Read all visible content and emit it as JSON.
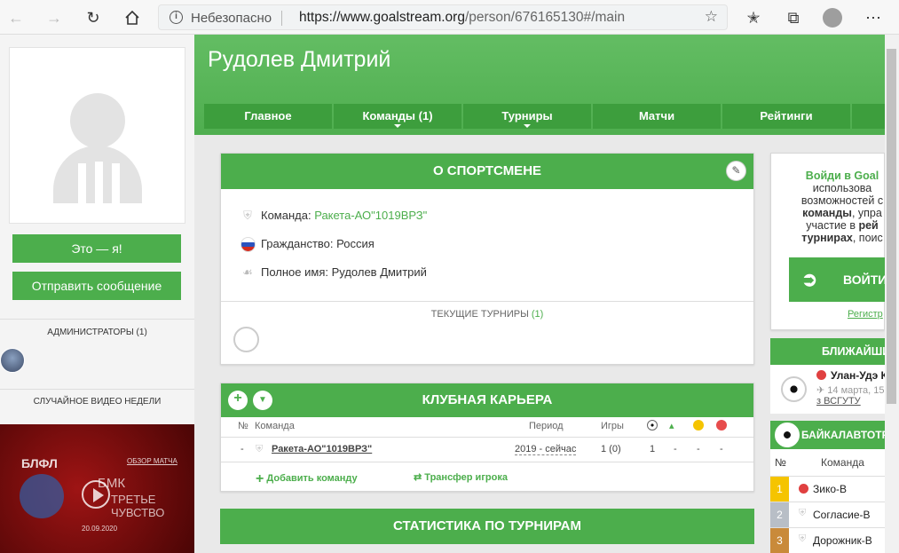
{
  "browser": {
    "security_label": "Небезопасно",
    "url_host": "https://www.goalstream.org",
    "url_path": "/person/676165130#/main"
  },
  "profile": {
    "name": "Рудолев Дмитрий",
    "btn_me": "Это — я!",
    "btn_message": "Отправить сообщение"
  },
  "nav": {
    "tabs": [
      "Главное",
      "Команды (1)",
      "Турниры",
      "Матчи",
      "Рейтинги"
    ]
  },
  "sidebar": {
    "admins_title": "АДМИНИСТРАТОРЫ (1)",
    "video_title": "СЛУЧАЙНОЕ ВИДЕО НЕДЕЛИ",
    "video": {
      "league": "БЛФЛ",
      "tag": "ОБЗОР МАТЧА",
      "team": "БМК",
      "subtitle": "ТРЕТЬЕ ЧУВСТВО",
      "date": "20.09.2020"
    }
  },
  "about": {
    "title": "О СПОРТСМЕНЕ",
    "team_label": "Команда:",
    "team_value": "Ракета-АО\"1019ВРЗ\"",
    "citizenship": "Гражданство: Россия",
    "fullname": "Полное имя: Рудолев Дмитрий",
    "current_tournaments_label": "ТЕКУЩИЕ ТУРНИРЫ",
    "current_tournaments_count": "(1)"
  },
  "career": {
    "title": "КЛУБНАЯ КАРЬЕРА",
    "headers": {
      "num": "№",
      "team": "Команда",
      "period": "Период",
      "games": "Игры"
    },
    "rows": [
      {
        "num": "-",
        "team": "Ракета-АО\"1019ВРЗ\"",
        "period": "2019 - сейчас",
        "games": "1 (0)",
        "goals": "1",
        "assists": "-",
        "yellow": "-",
        "red": "-"
      }
    ],
    "add_team": "Добавить команду",
    "transfer": "Трансфер игрока"
  },
  "stats": {
    "title": "СТАТИСТИКА ПО ТУРНИРАМ"
  },
  "login": {
    "line1": "Войди в Goal",
    "line2": "использова",
    "line3": "возможностей с",
    "line4a": "команды",
    "line4b": ", упра",
    "line5a": "участие в ",
    "line5b": "рей",
    "line6a": "турнирах",
    "line6b": ", поис",
    "button": "ВОЙТИ",
    "register": "Регистр"
  },
  "nearest": {
    "title": "БЛИЖАЙШИ",
    "team": "Улан-Удэ К",
    "date": "14 марта, 15",
    "league": "з ВСГУТУ"
  },
  "standings": {
    "title": "БАЙКАЛАВТОТР",
    "headers": {
      "num": "№",
      "team": "Команда"
    },
    "rows": [
      {
        "pos": "1",
        "team": "Зико-В",
        "color": "#f5c400"
      },
      {
        "pos": "2",
        "team": "Согласие-В",
        "color": "#b8bec6"
      },
      {
        "pos": "3",
        "team": "Дорожник-В",
        "color": "#c98a3a"
      }
    ]
  },
  "colors": {
    "brand": "#4cae4c",
    "yellow_card": "#f5c400",
    "red_card": "#e74c4c"
  }
}
